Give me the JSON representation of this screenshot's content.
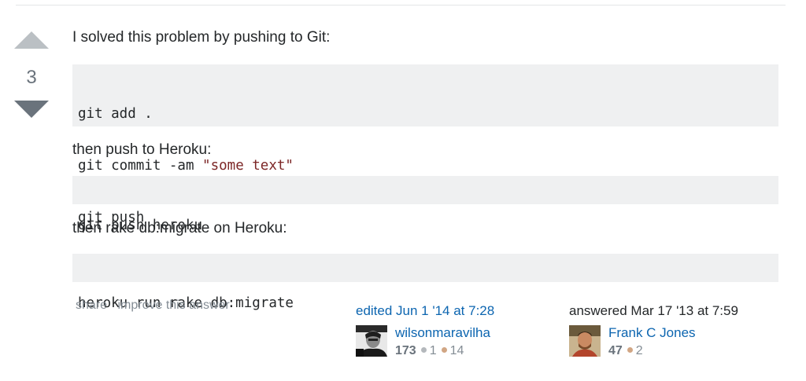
{
  "vote": {
    "score": "3"
  },
  "post": {
    "intro": "I solved this problem by pushing to Git:",
    "code1": [
      "git add .",
      "git commit -am ",
      "\"some text\"",
      "git push"
    ],
    "p2": "then push to Heroku:",
    "code2": "git push heroku",
    "p3": "then rake db:migrate on Heroku:",
    "code3": "heroku run rake db:migrate"
  },
  "menu": {
    "share": "share",
    "improve": "improve this answer"
  },
  "edited": {
    "action": "edited Jun 1 '14 at 7:28",
    "user": "wilsonmaravilha",
    "reputation": "173",
    "silver": "1",
    "bronze": "14",
    "avatar_icon": "user-avatar-bw"
  },
  "answered": {
    "action": "answered Mar 17 '13 at 7:59",
    "user": "Frank C Jones",
    "reputation": "47",
    "bronze": "2",
    "avatar_icon": "user-avatar-color"
  },
  "colors": {
    "link": "#0c65b0",
    "code_bg": "#eff0f1",
    "string": "#7d2727",
    "muted": "#848d95",
    "silver_badge": "#b4b8bc",
    "bronze_badge": "#d1a684"
  }
}
